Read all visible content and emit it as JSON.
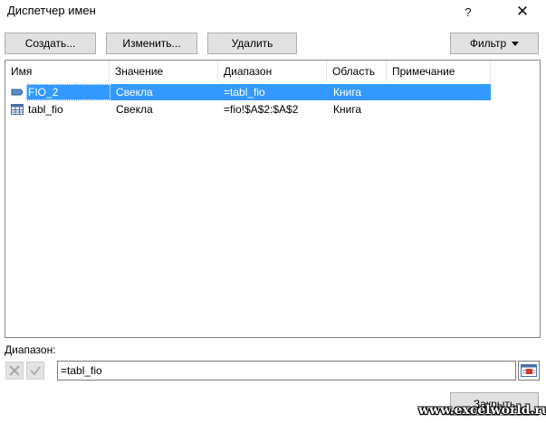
{
  "window": {
    "title": "Диспетчер имен",
    "help_label": "?",
    "close_label": "✕"
  },
  "toolbar": {
    "create_label": "Создать...",
    "edit_label": "Изменить...",
    "delete_label": "Удалить",
    "filter_label": "Фильтр"
  },
  "table": {
    "columns": [
      "Имя",
      "Значение",
      "Диапазон",
      "Область",
      "Примечание"
    ],
    "rows": [
      {
        "name": "FIO_2",
        "value": "Свекла",
        "range": "=tabl_fio",
        "scope": "Книга",
        "comment": "",
        "icon": "named-range-icon",
        "selected": true
      },
      {
        "name": "tabl_fio",
        "value": "Свекла",
        "range": "=fio!$A$2:$A$2",
        "scope": "Книга",
        "comment": "",
        "icon": "table-icon",
        "selected": false
      }
    ]
  },
  "range": {
    "label": "Диапазон:",
    "value": "=tabl_fio"
  },
  "footer": {
    "close_label": "Закрыть"
  },
  "watermark": "www.excelworld.ru",
  "colors": {
    "selection": "#3399ff",
    "button_bg": "#e1e1e1"
  }
}
